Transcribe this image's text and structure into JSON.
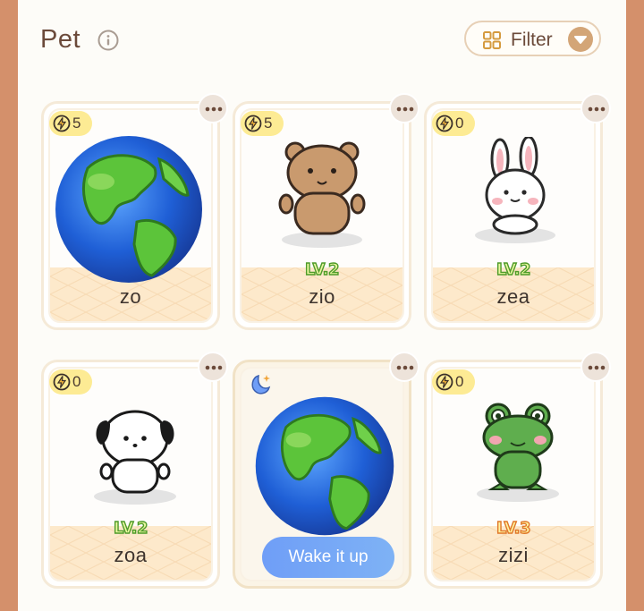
{
  "header": {
    "title": "Pet",
    "info_icon": "info-icon",
    "filter_label": "Filter",
    "filter_icon": "grid-icon",
    "filter_arrow_icon": "chevron-down-icon"
  },
  "colors": {
    "background_border": "#d4906b",
    "panel": "#fdfcf8",
    "energy_badge": "#fdeb94",
    "card_bottom": "#fde9cb",
    "wake_button": "#7aa7f6",
    "level_green": "#4e9b2a",
    "level_orange": "#e0782a"
  },
  "pets": [
    {
      "name": "zo",
      "energy": "5",
      "level": "",
      "art": "earth",
      "state": "normal"
    },
    {
      "name": "zio",
      "energy": "5",
      "level": "LV.2",
      "art": "bear",
      "state": "normal"
    },
    {
      "name": "zea",
      "energy": "0",
      "level": "LV.2",
      "art": "bunny",
      "state": "normal"
    },
    {
      "name": "zoa",
      "energy": "0",
      "level": "LV.2",
      "art": "puppy",
      "state": "normal"
    },
    {
      "name": "",
      "energy": "",
      "level": "",
      "art": "earth",
      "state": "sleeping",
      "wake_label": "Wake it up"
    },
    {
      "name": "zizi",
      "energy": "0",
      "level": "LV.3",
      "art": "frog",
      "state": "normal"
    }
  ]
}
